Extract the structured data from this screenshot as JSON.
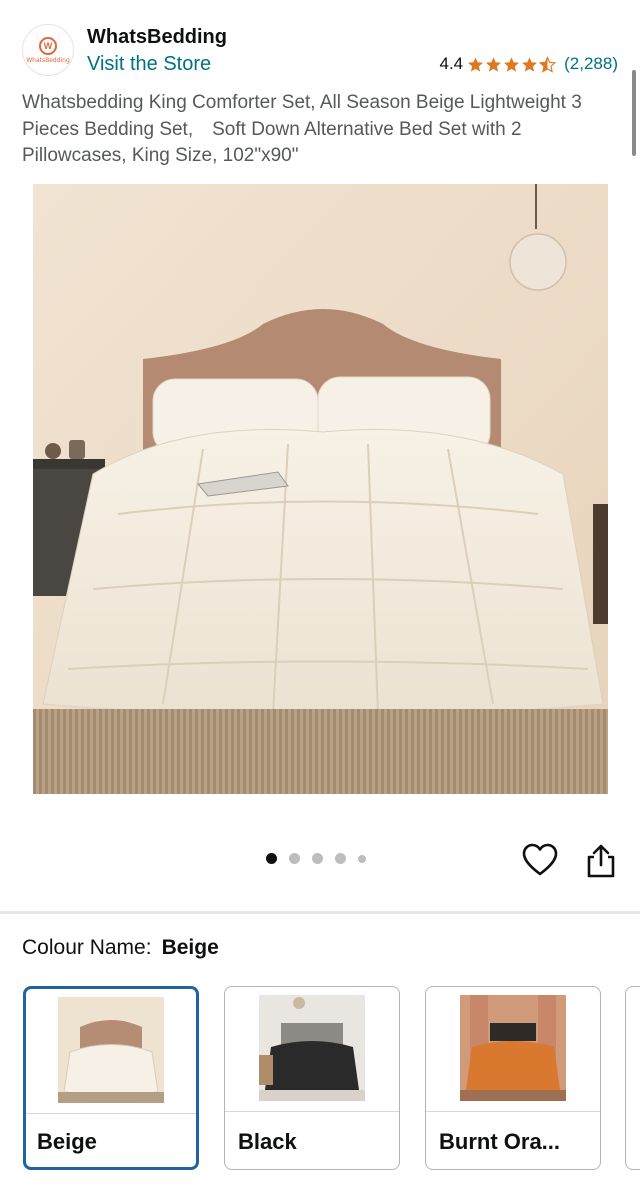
{
  "brand": {
    "logo_text": "WhatsBedding",
    "name": "WhatsBedding",
    "visit_store": "Visit the Store"
  },
  "rating": {
    "value": "4.4",
    "stars": 4.4,
    "count": "(2,288)",
    "star_color": "#de7921"
  },
  "product": {
    "title": "Whatsbedding King Comforter Set, All Season Beige Lightweight 3 Pieces Bedding Set,　Soft Down Alternative Bed Set with 2 Pillowcases, King Size, 102\"x90\"",
    "image_icon": "comforter-bed-photo"
  },
  "carousel": {
    "total_dots": 5,
    "active_index": 0
  },
  "actions": {
    "favorite_icon": "heart-icon",
    "share_icon": "share-icon"
  },
  "colour": {
    "label": "Colour Name:",
    "selected": "Beige",
    "options": [
      {
        "name": "Beige",
        "color": "#f3ece0"
      },
      {
        "name": "Black",
        "color": "#2a2a2a"
      },
      {
        "name": "Burnt Ora...",
        "color": "#d9782f"
      }
    ]
  },
  "colors": {
    "link": "#007185",
    "selected_border": "#2162a1"
  }
}
